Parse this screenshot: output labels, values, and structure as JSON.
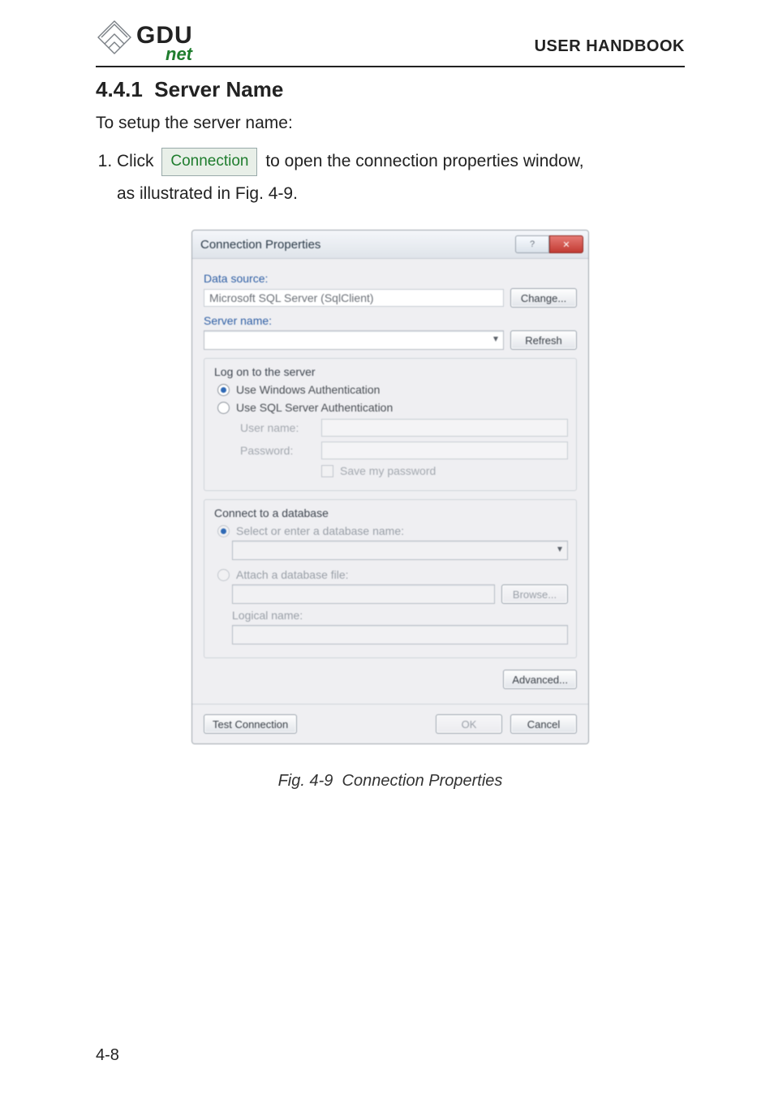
{
  "header": {
    "logo_main": "GDU",
    "logo_sub": "net",
    "right_title": "USER HANDBOOK"
  },
  "section": {
    "number": "4.4.1",
    "title": "Server Name",
    "intro": "To setup the server name:",
    "step1_pre": "Click",
    "step1_btn": "Connection",
    "step1_post": "to open the connection properties window,",
    "step1_cont_a": "as illustrated in",
    "step1_cont_b": "Fig. 4-9."
  },
  "dialog": {
    "title": "Connection Properties",
    "help_glyph": "?",
    "close_glyph": "✕",
    "data_source_label": "Data source:",
    "data_source_value": "Microsoft SQL Server (SqlClient)",
    "change_btn": "Change...",
    "server_name_label": "Server name:",
    "refresh_btn": "Refresh",
    "logon_group": "Log on to the server",
    "auth_windows": "Use Windows Authentication",
    "auth_sql": "Use SQL Server Authentication",
    "user_name_label": "User name:",
    "password_label": "Password:",
    "save_pw_label": "Save my password",
    "db_group": "Connect to a database",
    "db_select_radio": "Select or enter a database name:",
    "db_attach_radio": "Attach a database file:",
    "browse_btn": "Browse...",
    "logical_name_label": "Logical name:",
    "advanced_btn": "Advanced...",
    "test_btn": "Test Connection",
    "ok_btn": "OK",
    "cancel_btn": "Cancel"
  },
  "caption": {
    "fig": "Fig. 4-9",
    "text": "Connection Properties"
  },
  "page_number": "4-8"
}
